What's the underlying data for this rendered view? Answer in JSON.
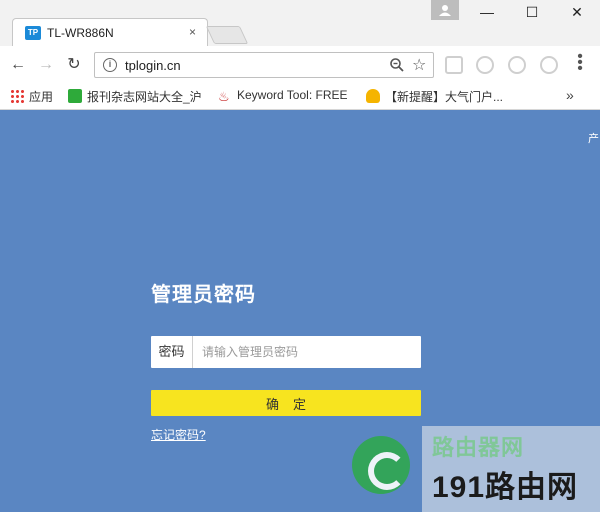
{
  "browser": {
    "tab": {
      "favicon_text": "TP",
      "title": "TL-WR886N",
      "close_label": "×"
    },
    "window": {
      "minimize": "—",
      "maximize": "☐",
      "close": "✕"
    },
    "toolbar": {
      "url": "tplogin.cn",
      "back": "←",
      "forward": "→",
      "reload": "↻",
      "bookmark_star": "☆",
      "menu": "⋮"
    },
    "bookmarks": {
      "apps_label": "应用",
      "items": [
        {
          "label": "报刊杂志网站大全_沪",
          "icon": "green-c-icon"
        },
        {
          "label": "Keyword Tool: FREE",
          "icon": "flame-icon"
        },
        {
          "label": "【新提醒】大气门户...",
          "icon": "trophy-icon"
        }
      ],
      "more": "»"
    }
  },
  "page": {
    "corner_text": "产",
    "login": {
      "title": "管理员密码",
      "password_label": "密码",
      "password_placeholder": "请输入管理员密码",
      "confirm_label": "确定",
      "forgot_link": "忘记密码?"
    },
    "watermark": {
      "top_text": "路由器网",
      "big_text": "191路由网"
    }
  },
  "colors": {
    "page_background": "#5a86c2",
    "confirm_button": "#f7e41f",
    "tab_favicon": "#1b8ad8"
  }
}
